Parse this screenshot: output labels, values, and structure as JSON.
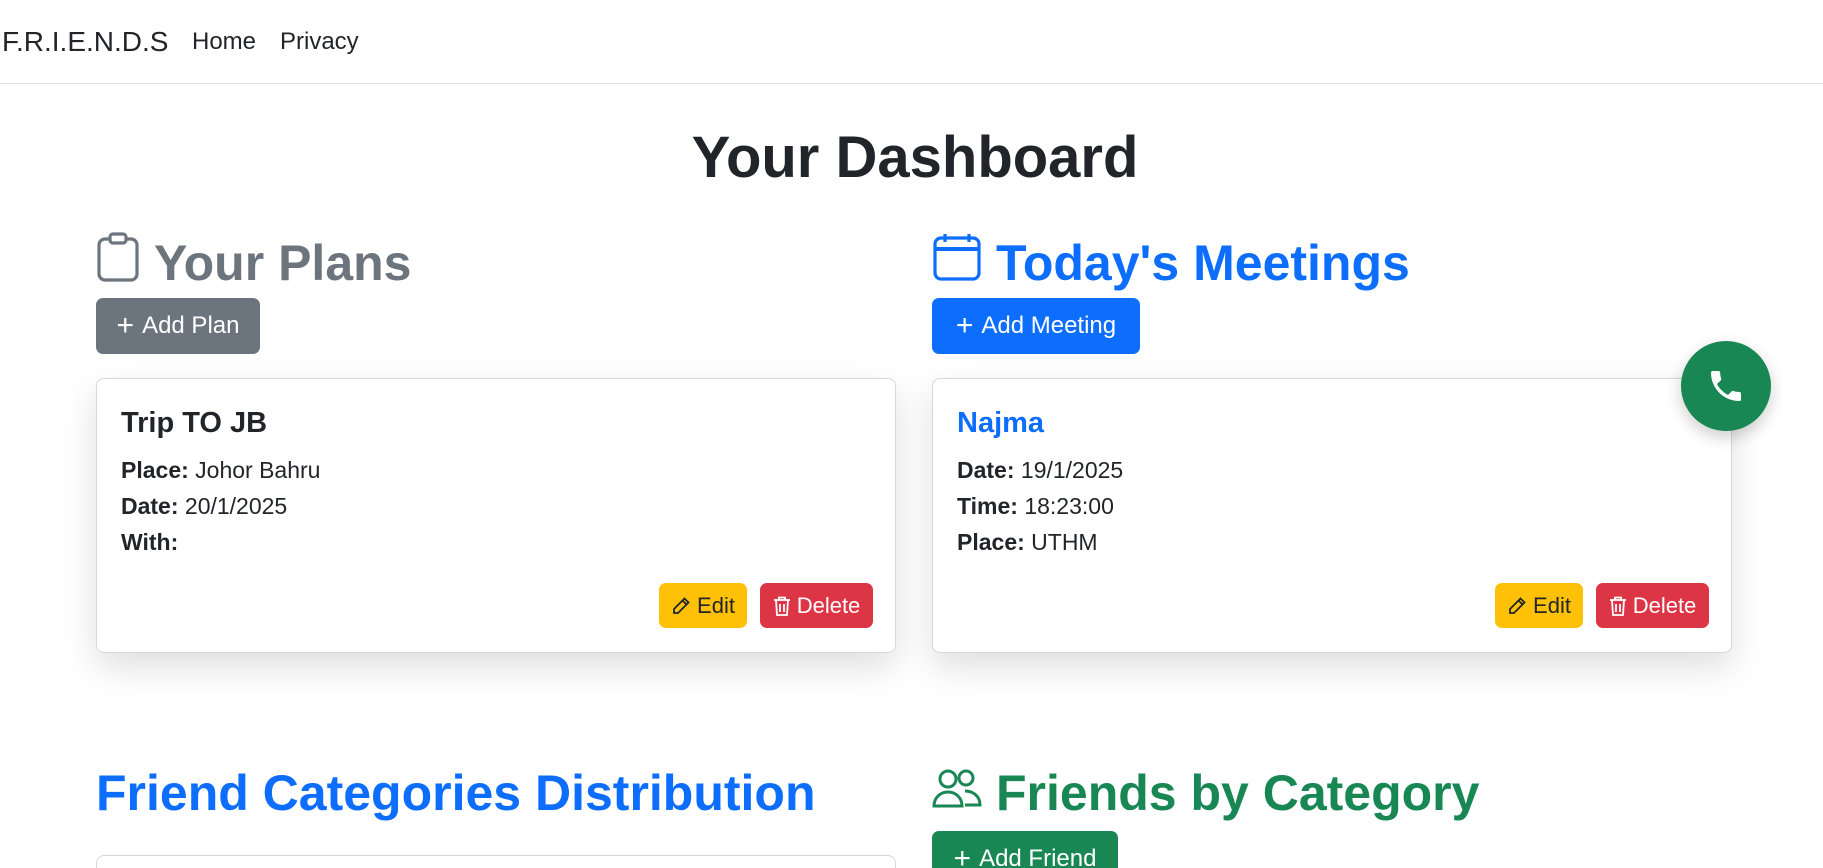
{
  "navbar": {
    "brand": "F.R.I.E.N.D.S",
    "links": [
      "Home",
      "Privacy"
    ]
  },
  "page_title": "Your Dashboard",
  "plans": {
    "title": "Your Plans",
    "icon": "clipboard-icon",
    "add_label": "Add Plan",
    "cards": [
      {
        "title": "Trip TO JB",
        "place_label": "Place:",
        "place": "Johor Bahru",
        "date_label": "Date:",
        "date": "20/1/2025",
        "with_label": "With:",
        "with": "",
        "edit_label": "Edit",
        "delete_label": "Delete"
      }
    ]
  },
  "meetings": {
    "title": "Today's Meetings",
    "icon": "calendar-icon",
    "add_label": "Add Meeting",
    "cards": [
      {
        "title": "Najma",
        "date_label": "Date:",
        "date": "19/1/2025",
        "time_label": "Time:",
        "time": "18:23:00",
        "place_label": "Place:",
        "place": "UTHM",
        "edit_label": "Edit",
        "delete_label": "Delete"
      }
    ]
  },
  "distribution": {
    "title": "Friend Categories Distribution"
  },
  "friends": {
    "title": "Friends by Category",
    "icon": "people-icon",
    "add_label": "Add Friend"
  },
  "call_button": {
    "icon": "phone-icon"
  },
  "colors": {
    "primary": "#0d6efd",
    "secondary": "#6c757d",
    "success": "#198754",
    "warning": "#ffc107",
    "danger": "#dc3545"
  }
}
